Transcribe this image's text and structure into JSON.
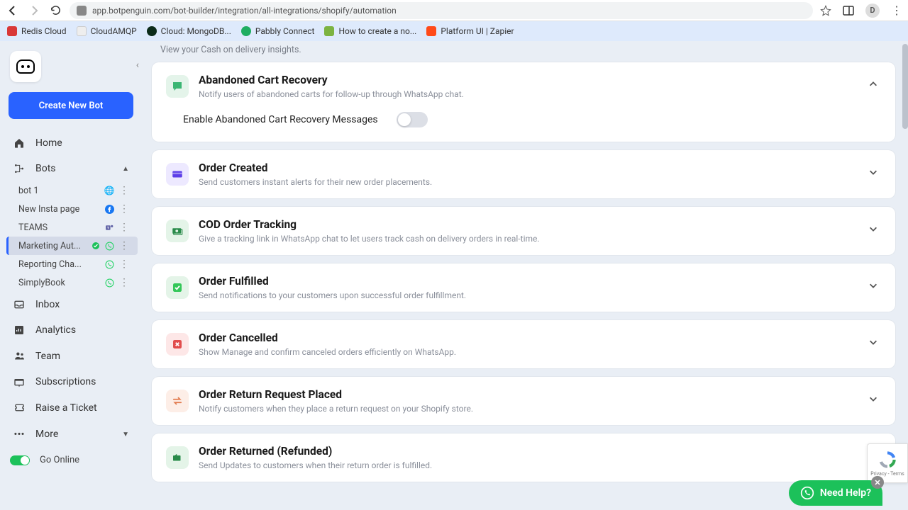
{
  "chrome": {
    "url": "app.botpenguin.com/bot-builder/integration/all-integrations/shopify/automation",
    "avatar": "D"
  },
  "bookmarks": [
    {
      "label": "Redis Cloud",
      "color": "#d93838"
    },
    {
      "label": "CloudAMQP",
      "color": "#a5a5a5"
    },
    {
      "label": "Cloud: MongoDB...",
      "color": "#1a8a3a"
    },
    {
      "label": "Pabbly Connect",
      "color": "#1fae62"
    },
    {
      "label": "How to create a no...",
      "color": "#7cb342"
    },
    {
      "label": "Platform UI | Zapier",
      "color": "#ff4a1a"
    }
  ],
  "sidebar": {
    "create": "Create New Bot",
    "home": "Home",
    "bots": "Bots",
    "inbox": "Inbox",
    "analytics": "Analytics",
    "team": "Team",
    "subs": "Subscriptions",
    "ticket": "Raise a Ticket",
    "more": "More",
    "online": "Go Online",
    "items": [
      {
        "label": "bot 1"
      },
      {
        "label": "New Insta page"
      },
      {
        "label": "TEAMS"
      },
      {
        "label": "Marketing Aut..."
      },
      {
        "label": "Reporting Cha..."
      },
      {
        "label": "SimplyBook"
      }
    ]
  },
  "main": {
    "insight": "View your Cash on delivery insights.",
    "expanded": {
      "title": "Abandoned Cart Recovery",
      "desc": "Notify users of abandoned carts for follow-up through WhatsApp chat.",
      "toggle_label": "Enable Abandoned Cart Recovery Messages"
    },
    "cards": [
      {
        "title": "Order Created",
        "desc": "Send customers instant alerts for their new order placements.",
        "bg": "#ede9ff",
        "fg": "#5c3ee8",
        "icon": "card"
      },
      {
        "title": "COD Order Tracking",
        "desc": "Give a tracking link in WhatsApp chat to let users track cash on delivery orders in real-time.",
        "bg": "#e4f4e8",
        "fg": "#2a8b4a",
        "icon": "cash"
      },
      {
        "title": "Order Fulfilled",
        "desc": "Send notifications to your customers upon successful order fulfillment.",
        "bg": "#e4f4e8",
        "fg": "#34c759",
        "icon": "check"
      },
      {
        "title": "Order Cancelled",
        "desc": "Show Manage and confirm canceled orders efficiently on WhatsApp.",
        "bg": "#fde7e7",
        "fg": "#e14d4d",
        "icon": "cross"
      },
      {
        "title": "Order Return Request Placed",
        "desc": "Notify customers when they place a return request on your Shopify store.",
        "bg": "#fdeee7",
        "fg": "#e17a4d",
        "icon": "swap"
      },
      {
        "title": "Order Returned (Refunded)",
        "desc": "Send Updates to customers when their return order is fulfilled.",
        "bg": "#e4f4e8",
        "fg": "#2a8b4a",
        "icon": "return"
      }
    ]
  },
  "help": "Need Help?",
  "recaptcha": "Privacy - Terms"
}
